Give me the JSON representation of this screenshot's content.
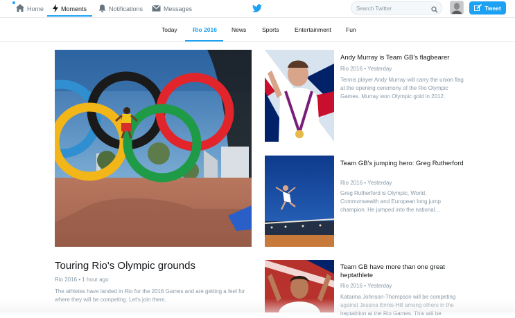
{
  "topnav": {
    "home_label": "Home",
    "moments_label": "Moments",
    "notifications_label": "Notifications",
    "messages_label": "Messages",
    "search_placeholder": "Search Twitter",
    "tweet_label": "Tweet"
  },
  "tabs": [
    {
      "label": "Today"
    },
    {
      "label": "Rio 2016",
      "active": true
    },
    {
      "label": "News"
    },
    {
      "label": "Sports"
    },
    {
      "label": "Entertainment"
    },
    {
      "label": "Fun"
    }
  ],
  "hero": {
    "title": "Touring Rio's Olympic grounds",
    "meta": "Rio 2016 • 1 hour ago",
    "description_line1": "The athletes have landed in Rio for the 2016 Games and are getting a feel for",
    "description_line2": "where they will be competing. Let's join them."
  },
  "cards": [
    {
      "title": "Andy Murray is Team GB's flagbearer",
      "meta": "Rio 2016 • Yesterday",
      "description": "Tennis player Andy Murray will carry the union flag at the opening ceremony of the Rio Olympic Games. Murray won Olympic gold in 2012."
    },
    {
      "title": "Team GB's jumping hero: Greg Rutherford",
      "meta": "Rio 2016 • Yesterday",
      "description": "Greg Rutherford is Olympic, World, Commonwealth and European long jump champion. He jumped into the national…"
    },
    {
      "title": "Team GB have more than one great heptathlete",
      "meta": "Rio 2016 • Yesterday",
      "description": "Katarina Johnson-Thompson will be competing against Jessica Ennis-Hill among others in the heptathlon at the Rio Games. This will be"
    }
  ],
  "colors": {
    "accent": "#1da1f2",
    "text": "#14171a",
    "muted": "#8899a6"
  },
  "icons": [
    "home-icon",
    "lightning-icon",
    "bell-icon",
    "envelope-icon",
    "twitter-bird-icon",
    "search-icon",
    "quill-icon"
  ]
}
